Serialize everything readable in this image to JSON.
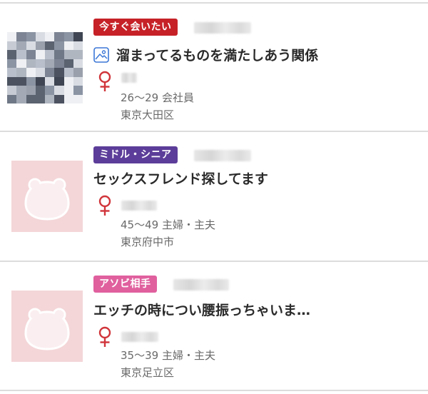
{
  "posts": [
    {
      "badge": "今すぐ会いたい",
      "badge_color": "#c62127",
      "title": "溜まってるものを満たしあう関係",
      "has_image_icon": true,
      "age_job": "26〜29 会社員",
      "location": "東京大田区",
      "thumb_type": "photo"
    },
    {
      "badge": "ミドル・シニア",
      "badge_color": "#5c3d99",
      "title": "セックスフレンド探してます",
      "has_image_icon": false,
      "age_job": "45〜49 主婦・主夫",
      "location": "東京府中市",
      "thumb_type": "placeholder"
    },
    {
      "badge": "アソビ相手",
      "badge_color": "#e0609e",
      "title": "エッチの時につい腰振っちゃいま…",
      "has_image_icon": false,
      "age_job": "35〜39 主婦・主夫",
      "location": "東京足立区",
      "thumb_type": "placeholder"
    }
  ],
  "icons": {
    "gender": "female-symbol-icon",
    "image": "picture-icon",
    "placeholder": "bear-silhouette-icon"
  },
  "colors": {
    "female_icon": "#d0343a",
    "image_icon": "#3b77d6",
    "placeholder_bg": "#f4d6d8",
    "text_main": "#2a2a2a",
    "text_meta": "#6a6a6a",
    "divider": "#dcdcdc"
  }
}
